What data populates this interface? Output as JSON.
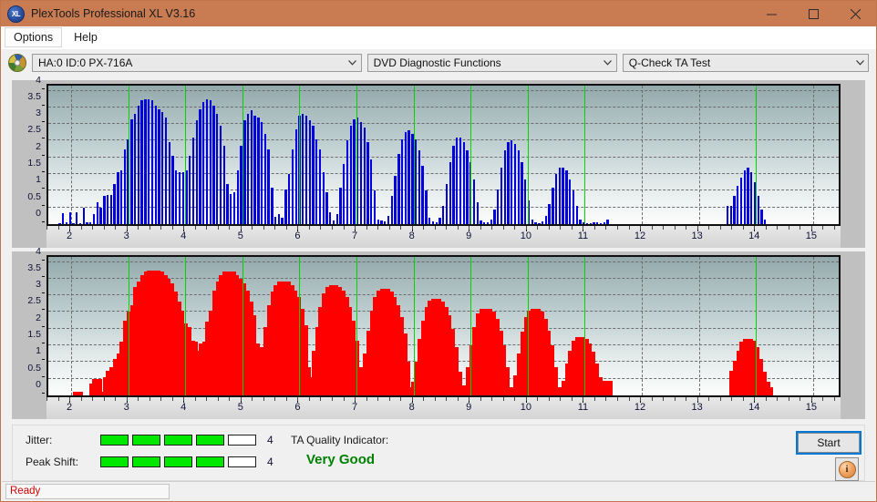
{
  "window": {
    "title": "PlexTools Professional XL V3.16",
    "icon": "xl-app-icon",
    "minimize": "minimize-icon",
    "maximize": "maximize-icon",
    "close": "close-icon"
  },
  "menu": {
    "items": [
      {
        "label": "Options",
        "name": "menu-options"
      },
      {
        "label": "Help",
        "name": "menu-help"
      }
    ]
  },
  "toolbar": {
    "drive_icon": "disc-icon",
    "drive_select": {
      "value": "HA:0 ID:0  PX-716A",
      "options": [
        "HA:0 ID:0  PX-716A"
      ]
    },
    "function_select": {
      "value": "DVD Diagnostic Functions",
      "options": [
        "DVD Diagnostic Functions"
      ]
    },
    "test_select": {
      "value": "Q-Check TA Test",
      "options": [
        "Q-Check TA Test"
      ]
    }
  },
  "results": {
    "jitter_label": "Jitter:",
    "jitter_value": "4",
    "jitter_segments": 5,
    "jitter_filled": 4,
    "peakshift_label": "Peak Shift:",
    "peakshift_value": "4",
    "peakshift_segments": 5,
    "peakshift_filled": 4,
    "ta_title": "TA Quality Indicator:",
    "ta_value": "Very Good",
    "ta_color": "#008000",
    "start_label": "Start",
    "info_label": "i"
  },
  "statusbar": {
    "text": "Ready",
    "color": "#d00000"
  },
  "chart_data": [
    {
      "type": "bar",
      "name": "jitter-chart",
      "title": "",
      "xlabel": "",
      "ylabel": "",
      "series_color": "#0000dd",
      "xlim": [
        1.6,
        15.45
      ],
      "ylim": [
        0,
        4.15
      ],
      "yticks": [
        0,
        0.5,
        1,
        1.5,
        2,
        2.5,
        3,
        3.5,
        4
      ],
      "xticks": [
        2,
        3,
        4,
        5,
        6,
        7,
        8,
        9,
        10,
        11,
        12,
        13,
        14,
        15
      ],
      "grid": true,
      "markers": [
        3,
        4,
        5,
        6,
        7,
        8,
        9,
        10,
        11,
        14
      ],
      "marker_color": "#00d400",
      "x": [
        1.8,
        1.86,
        1.92,
        1.98,
        2.04,
        2.1,
        2.16,
        2.22,
        2.28,
        2.34,
        2.4,
        2.46,
        2.52,
        2.58,
        2.64,
        2.7,
        2.76,
        2.82,
        2.88,
        2.94,
        3.0,
        3.06,
        3.12,
        3.18,
        3.24,
        3.3,
        3.36,
        3.42,
        3.48,
        3.54,
        3.6,
        3.66,
        3.72,
        3.78,
        3.84,
        3.9,
        3.96,
        4.02,
        4.08,
        4.14,
        4.2,
        4.26,
        4.32,
        4.38,
        4.44,
        4.5,
        4.56,
        4.62,
        4.68,
        4.74,
        4.8,
        4.86,
        4.92,
        4.98,
        5.04,
        5.1,
        5.16,
        5.22,
        5.28,
        5.34,
        5.4,
        5.46,
        5.52,
        5.58,
        5.64,
        5.7,
        5.76,
        5.82,
        5.88,
        5.94,
        6.0,
        6.06,
        6.12,
        6.18,
        6.24,
        6.3,
        6.36,
        6.42,
        6.48,
        6.54,
        6.6,
        6.66,
        6.72,
        6.78,
        6.84,
        6.9,
        6.96,
        7.02,
        7.08,
        7.14,
        7.2,
        7.26,
        7.32,
        7.38,
        7.44,
        7.5,
        7.56,
        7.62,
        7.68,
        7.74,
        7.8,
        7.86,
        7.92,
        7.98,
        8.04,
        8.1,
        8.16,
        8.22,
        8.28,
        8.34,
        8.4,
        8.46,
        8.52,
        8.58,
        8.64,
        8.7,
        8.76,
        8.82,
        8.88,
        8.94,
        9.0,
        9.06,
        9.12,
        9.18,
        9.24,
        9.3,
        9.36,
        9.42,
        9.48,
        9.54,
        9.6,
        9.66,
        9.72,
        9.78,
        9.84,
        9.9,
        9.96,
        10.02,
        10.08,
        10.14,
        10.2,
        10.26,
        10.32,
        10.38,
        10.44,
        10.5,
        10.56,
        10.62,
        10.68,
        10.74,
        10.8,
        10.86,
        10.92,
        10.98,
        11.04,
        11.1,
        11.16,
        11.22,
        11.28,
        11.34,
        11.4,
        13.5,
        13.56,
        13.62,
        13.68,
        13.74,
        13.8,
        13.86,
        13.92,
        13.98,
        14.04,
        14.1,
        14.16,
        14.22
      ],
      "values": [
        0.02,
        0.33,
        0.05,
        0.35,
        0.04,
        0.35,
        0.03,
        0.5,
        0.06,
        0.05,
        0.3,
        0.65,
        0.5,
        0.85,
        0.88,
        0.88,
        1.2,
        1.55,
        1.6,
        2.25,
        2.55,
        3.15,
        3.3,
        3.55,
        3.7,
        3.75,
        3.75,
        3.7,
        3.55,
        3.45,
        3.35,
        3.2,
        2.45,
        2.05,
        1.6,
        1.55,
        1.55,
        1.6,
        2.05,
        2.6,
        3.1,
        3.45,
        3.65,
        3.75,
        3.7,
        3.55,
        3.3,
        2.95,
        2.35,
        1.2,
        0.9,
        0.95,
        1.6,
        2.35,
        3.1,
        3.3,
        3.4,
        3.25,
        3.2,
        3.05,
        2.7,
        2.25,
        1.1,
        0.22,
        0.3,
        0.2,
        1.05,
        1.5,
        2.25,
        2.85,
        3.25,
        3.3,
        3.25,
        3.1,
        2.95,
        2.55,
        2.25,
        1.55,
        0.95,
        0.35,
        0.12,
        0.3,
        1.1,
        1.8,
        2.5,
        2.95,
        3.15,
        3.2,
        3.05,
        2.9,
        2.45,
        1.95,
        1.0,
        0.15,
        0.1,
        0.08,
        0.25,
        0.85,
        1.45,
        2.1,
        2.55,
        2.75,
        2.8,
        2.7,
        2.55,
        2.2,
        1.75,
        1.0,
        0.2,
        0.08,
        0.05,
        0.2,
        0.55,
        1.2,
        1.85,
        2.35,
        2.6,
        2.6,
        2.45,
        2.2,
        1.85,
        1.35,
        0.65,
        0.12,
        0.05,
        0.05,
        0.15,
        0.45,
        1.05,
        1.7,
        2.2,
        2.45,
        2.5,
        2.4,
        2.2,
        1.85,
        1.35,
        0.7,
        0.15,
        0.05,
        0.04,
        0.08,
        0.25,
        0.6,
        1.1,
        1.5,
        1.7,
        1.7,
        1.6,
        1.35,
        1.0,
        0.55,
        0.15,
        0.05,
        0.03,
        0.04,
        0.05,
        0.05,
        0.03,
        0.05,
        0.15,
        0.55,
        0.55,
        0.85,
        1.15,
        1.4,
        1.6,
        1.7,
        1.55,
        1.25,
        0.85,
        0.45,
        0.15
      ]
    },
    {
      "type": "bar",
      "name": "peak-shift-chart",
      "title": "",
      "xlabel": "",
      "ylabel": "",
      "series_color": "#ff0000",
      "xlim": [
        1.6,
        15.45
      ],
      "ylim": [
        0,
        4.15
      ],
      "yticks": [
        0,
        0.5,
        1,
        1.5,
        2,
        2.5,
        3,
        3.5,
        4
      ],
      "xticks": [
        2,
        3,
        4,
        5,
        6,
        7,
        8,
        9,
        10,
        11,
        12,
        13,
        14,
        15
      ],
      "grid": true,
      "markers": [
        3,
        4,
        5,
        6,
        7,
        8,
        9,
        10,
        11,
        14
      ],
      "marker_color": "#00d400",
      "x": [
        2.12,
        2.4,
        2.46,
        2.52,
        2.58,
        2.64,
        2.7,
        2.76,
        2.82,
        2.88,
        2.94,
        3.0,
        3.06,
        3.12,
        3.18,
        3.24,
        3.3,
        3.36,
        3.42,
        3.48,
        3.54,
        3.6,
        3.66,
        3.72,
        3.78,
        3.84,
        3.9,
        3.96,
        4.02,
        4.08,
        4.14,
        4.2,
        4.26,
        4.32,
        4.38,
        4.44,
        4.5,
        4.56,
        4.62,
        4.68,
        4.74,
        4.8,
        4.86,
        4.92,
        4.98,
        5.04,
        5.1,
        5.16,
        5.22,
        5.28,
        5.34,
        5.4,
        5.46,
        5.52,
        5.58,
        5.64,
        5.7,
        5.76,
        5.82,
        5.88,
        5.94,
        6.0,
        6.06,
        6.12,
        6.18,
        6.24,
        6.3,
        6.36,
        6.42,
        6.48,
        6.54,
        6.6,
        6.66,
        6.72,
        6.78,
        6.84,
        6.9,
        6.96,
        7.02,
        7.08,
        7.14,
        7.2,
        7.26,
        7.32,
        7.38,
        7.44,
        7.5,
        7.56,
        7.62,
        7.68,
        7.74,
        7.8,
        7.86,
        7.92,
        7.98,
        8.04,
        8.1,
        8.16,
        8.22,
        8.28,
        8.34,
        8.4,
        8.46,
        8.52,
        8.58,
        8.64,
        8.7,
        8.76,
        8.82,
        8.88,
        8.94,
        9.0,
        9.06,
        9.12,
        9.18,
        9.24,
        9.3,
        9.36,
        9.42,
        9.48,
        9.54,
        9.6,
        9.66,
        9.72,
        9.78,
        9.84,
        9.9,
        9.96,
        10.02,
        10.08,
        10.14,
        10.2,
        10.26,
        10.32,
        10.38,
        10.44,
        10.5,
        10.56,
        10.62,
        10.68,
        10.74,
        10.8,
        10.86,
        10.92,
        10.98,
        11.04,
        11.1,
        11.16,
        11.22,
        11.28,
        11.34,
        11.4,
        13.62,
        13.68,
        13.74,
        13.8,
        13.86,
        13.92,
        13.98,
        14.04,
        14.1,
        14.16,
        14.22,
        14.28
      ],
      "values": [
        0.1,
        0.35,
        0.5,
        0.1,
        0.08,
        0.55,
        0.75,
        0.85,
        1.1,
        1.25,
        1.6,
        2.25,
        2.5,
        2.7,
        3.25,
        3.4,
        3.6,
        3.7,
        3.75,
        3.75,
        3.7,
        3.6,
        3.5,
        3.35,
        3.1,
        2.8,
        2.55,
        2.15,
        2.05,
        1.65,
        1.6,
        1.35,
        1.25,
        1.55,
        1.6,
        2.2,
        2.55,
        3.15,
        3.4,
        3.6,
        3.7,
        3.7,
        3.6,
        3.5,
        3.35,
        3.15,
        2.8,
        2.4,
        1.55,
        0.75,
        0.85,
        1.45,
        2.05,
        2.7,
        3.1,
        3.3,
        3.4,
        3.4,
        3.3,
        3.15,
        2.95,
        2.6,
        2.1,
        0.85,
        0.25,
        0.55,
        1.35,
        2.05,
        2.65,
        3.05,
        3.25,
        3.3,
        3.25,
        3.15,
        2.95,
        2.65,
        2.25,
        1.65,
        0.85,
        0.25,
        0.45,
        1.25,
        1.95,
        2.55,
        2.95,
        3.15,
        3.2,
        3.1,
        2.95,
        2.7,
        2.35,
        1.85,
        1.0,
        0.25,
        0.15,
        0.4,
        1.0,
        1.7,
        2.25,
        2.65,
        2.85,
        2.9,
        2.8,
        2.65,
        2.4,
        2.0,
        1.45,
        0.7,
        0.15,
        0.1,
        0.3,
        0.85,
        1.5,
        2.05,
        2.45,
        2.6,
        2.6,
        2.5,
        2.3,
        1.95,
        1.5,
        0.85,
        0.25,
        0.1,
        0.2,
        0.6,
        1.25,
        1.9,
        2.35,
        2.55,
        2.6,
        2.5,
        2.3,
        1.95,
        1.5,
        0.85,
        0.25,
        0.1,
        0.15,
        0.45,
        0.95,
        1.35,
        1.65,
        1.75,
        1.7,
        1.55,
        1.3,
        0.95,
        0.55,
        0.15,
        0.05,
        0.45,
        0.75,
        1.05,
        1.35,
        1.6,
        1.7,
        1.65,
        1.45,
        1.1,
        0.7,
        0.4,
        0.25
      ]
    }
  ]
}
